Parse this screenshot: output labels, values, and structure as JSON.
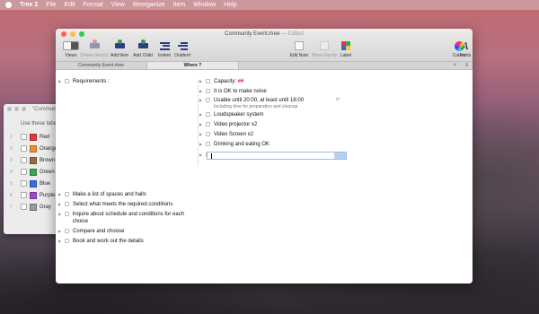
{
  "menubar": {
    "app": "Tree 2",
    "items": [
      "File",
      "Edit",
      "Format",
      "View",
      "Reorganize",
      "Item",
      "Window",
      "Help"
    ]
  },
  "label_window": {
    "title": "\"Commun",
    "hint": "Use these label",
    "labels": [
      {
        "num": "1",
        "name": "Red",
        "color": "#e23a3a"
      },
      {
        "num": "2",
        "name": "Orange",
        "color": "#f08c2e"
      },
      {
        "num": "3",
        "name": "Brown",
        "color": "#9a6a3a"
      },
      {
        "num": "4",
        "name": "Green",
        "color": "#3aa54a"
      },
      {
        "num": "5",
        "name": "Blue",
        "color": "#3a6ee0"
      },
      {
        "num": "6",
        "name": "Purple",
        "color": "#9a4ad0"
      },
      {
        "num": "7",
        "name": "Gray",
        "color": "#9a9a9a"
      }
    ]
  },
  "window": {
    "title": "Community Event.rtree",
    "edited": "— Edited",
    "toolbar": {
      "views": "Views",
      "delete_items": "Delete Item(s)",
      "add_item": "Add Item",
      "add_child": "Add Child",
      "indent": "Indent",
      "outdent": "Outdent",
      "edit_note": "Edit Note",
      "show_family": "Show Family",
      "label": "Label",
      "colors": "Colors",
      "fonts": "Fonts"
    },
    "tabs": [
      "Community Event.rtree",
      "Where ?"
    ],
    "outline": {
      "root": "Requirements :",
      "children": [
        {
          "prefix": "Capacity: ",
          "highlight": "##"
        },
        {
          "text": "It is OK to make noise"
        },
        {
          "text": "Usable until 20:00, at least until 18:00",
          "note": "Including time for preparation and cleanup"
        },
        {
          "text": "Loudspeaker system"
        },
        {
          "text": "Video projector x2"
        },
        {
          "text": "Video Screen x2"
        },
        {
          "text": "Drinking and eating OK"
        }
      ],
      "para_mark": "¶*",
      "tasks": [
        "Make a list of spaces and halls",
        "Select what meets the required conditions",
        "Inquire about schedule and conditions for each choice",
        "Compare and choose",
        "Book and work out the details"
      ]
    }
  },
  "colors": {
    "traffic_red": "#fc605b",
    "traffic_yellow": "#fdbc40",
    "traffic_green": "#34c84a"
  }
}
